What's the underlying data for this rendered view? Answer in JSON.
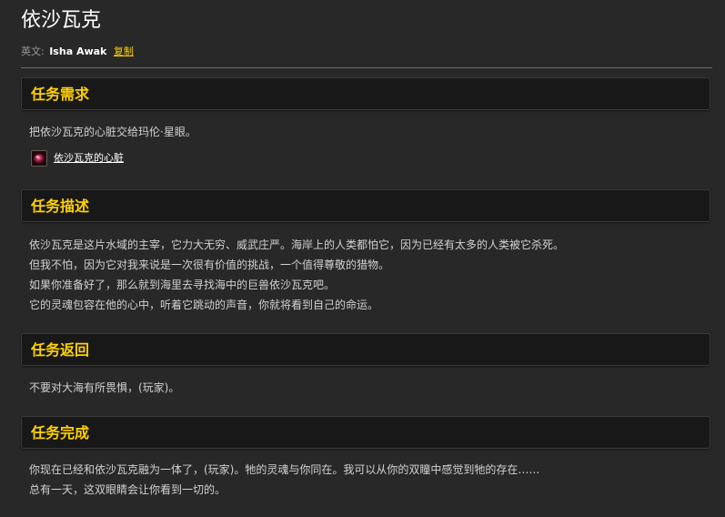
{
  "quest": {
    "title": "依沙瓦克",
    "english_label": "英文:",
    "english_name": "Isha Awak",
    "copy_label": "复制"
  },
  "sections": {
    "requirements": {
      "heading": "任务需求",
      "text": "把依沙瓦克的心脏交给玛伦·星眼。",
      "item": {
        "name": "依沙瓦克的心脏",
        "icon": "heart-item-icon"
      }
    },
    "description": {
      "heading": "任务描述",
      "lines": [
        "依沙瓦克是这片水域的主宰，它力大无穷、威武庄严。海岸上的人类都怕它，因为已经有太多的人类被它杀死。",
        "但我不怕，因为它对我来说是一次很有价值的挑战，一个值得尊敬的猎物。",
        "如果你准备好了，那么就到海里去寻找海中的巨兽依沙瓦克吧。",
        "它的灵魂包容在他的心中，听着它跳动的声音，你就将看到自己的命运。"
      ]
    },
    "progress": {
      "heading": "任务返回",
      "text": "不要对大海有所畏惧，(玩家)。"
    },
    "completion": {
      "heading": "任务完成",
      "lines": [
        "你现在已经和依沙瓦克融为一体了，(玩家)。牠的灵魂与你同在。我可以从你的双瞳中感觉到牠的存在……",
        "总有一天，这双眼睛会让你看到一切的。"
      ]
    }
  },
  "colors": {
    "background": "#282828",
    "heading_gold": "#ffd100",
    "link_gold": "#ffd100",
    "header_bar": "#181818",
    "body_text": "#d2d2d2"
  }
}
